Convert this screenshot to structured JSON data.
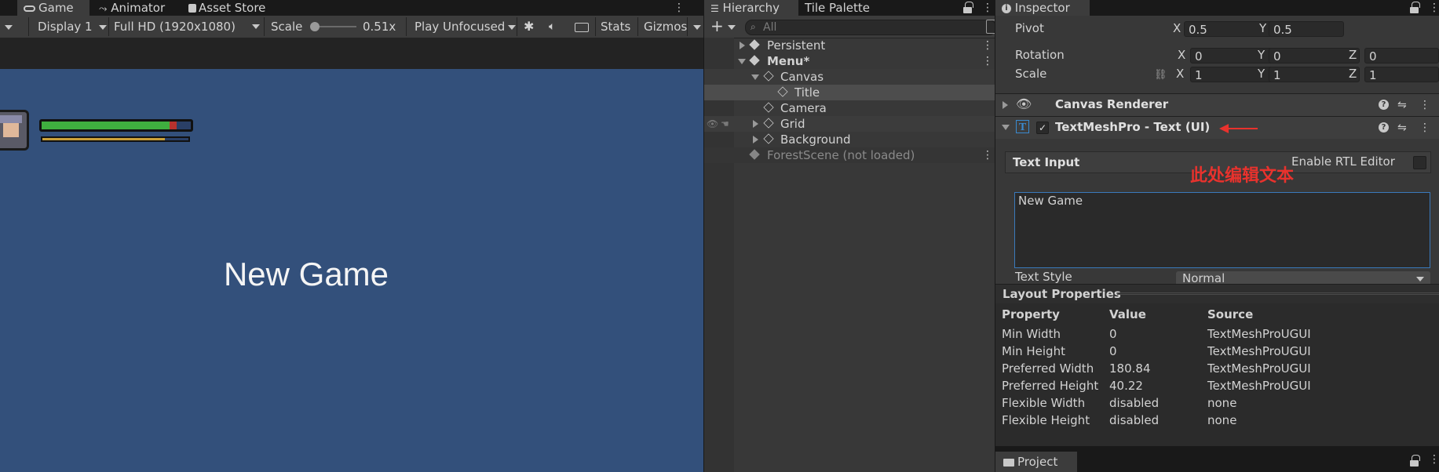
{
  "game_tabs": {
    "game": "Game",
    "animator": "Animator",
    "asset_store": "Asset Store"
  },
  "game_toolbar": {
    "display": "Display 1",
    "resolution": "Full HD (1920x1080)",
    "scale_label": "Scale",
    "scale_value": "0.51x",
    "scale_fraction": 0.05,
    "play_mode": "Play Unfocused",
    "stats": "Stats",
    "gizmos": "Gizmos"
  },
  "game_view": {
    "title_text": "New Game",
    "health_fraction": 0.86,
    "stamina_fraction": 0.84
  },
  "hierarchy": {
    "tab": "Hierarchy",
    "tab2": "Tile Palette",
    "search_placeholder": "All",
    "items": [
      {
        "label": "Persistent"
      },
      {
        "label": "Menu*"
      },
      {
        "label": "Canvas"
      },
      {
        "label": "Title"
      },
      {
        "label": "Camera"
      },
      {
        "label": "Grid"
      },
      {
        "label": "Background"
      },
      {
        "label": "ForestScene (not loaded)"
      }
    ]
  },
  "inspector": {
    "tab": "Inspector",
    "pivot": {
      "label": "Pivot",
      "x": "0.5",
      "y": "0.5"
    },
    "rotation": {
      "label": "Rotation",
      "x": "0",
      "y": "0",
      "z": "0"
    },
    "scale": {
      "label": "Scale",
      "x": "1",
      "y": "1",
      "z": "1"
    },
    "axis": {
      "x": "X",
      "y": "Y",
      "z": "Z"
    },
    "canvas_renderer": "Canvas Renderer",
    "tmp_component": "TextMeshPro - Text (UI)",
    "text_input_label": "Text Input",
    "enable_rtl": "Enable RTL Editor",
    "annotation": "此处编辑文本",
    "text_value": "New Game",
    "text_style_label": "Text Style",
    "text_style_value": "Normal"
  },
  "layout_properties": {
    "title": "Layout Properties",
    "headers": {
      "property": "Property",
      "value": "Value",
      "source": "Source"
    },
    "rows": [
      {
        "property": "Min Width",
        "value": "0",
        "source": "TextMeshProUGUI"
      },
      {
        "property": "Min Height",
        "value": "0",
        "source": "TextMeshProUGUI"
      },
      {
        "property": "Preferred Width",
        "value": "180.84",
        "source": "TextMeshProUGUI"
      },
      {
        "property": "Preferred Height",
        "value": "40.22",
        "source": "TextMeshProUGUI"
      },
      {
        "property": "Flexible Width",
        "value": "disabled",
        "source": "none"
      },
      {
        "property": "Flexible Height",
        "value": "disabled",
        "source": "none"
      }
    ]
  },
  "project_tab": "Project",
  "colors": {
    "game_bg": "#33507b",
    "annotation_red": "#e8322d",
    "health_green": "#3fae3f",
    "stamina_gold": "#c9a03a",
    "focus_blue": "#3a79bb"
  }
}
